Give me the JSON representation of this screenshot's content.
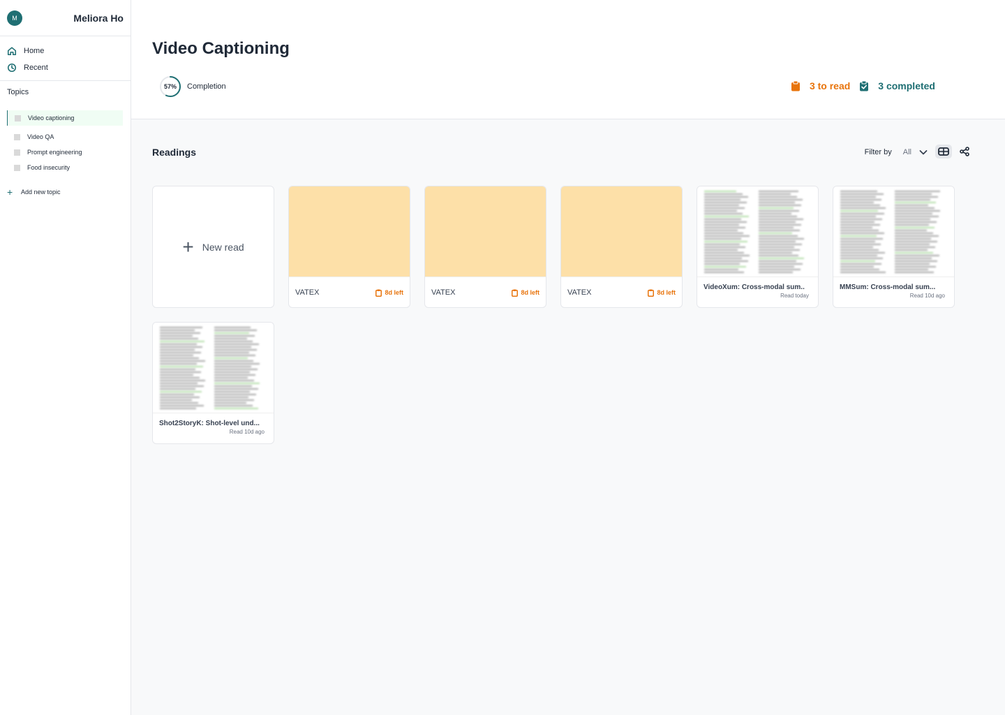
{
  "user": {
    "initial": "M",
    "name": "Meliora Ho"
  },
  "nav": [
    {
      "label": "Home",
      "icon": "home-icon"
    },
    {
      "label": "Recent",
      "icon": "clock-icon"
    }
  ],
  "topics": {
    "title": "Topics",
    "items": [
      {
        "label": "Video captioning",
        "active": true
      },
      {
        "label": "Video QA"
      },
      {
        "label": "Prompt engineering"
      },
      {
        "label": "Food insecurity"
      }
    ],
    "add_label": "Add new topic"
  },
  "header": {
    "title": "Video Captioning",
    "completion_percent": "57%",
    "completion_fraction": 0.57,
    "completion_label": "Completion",
    "to_read": "3 to read",
    "completed": "3 completed"
  },
  "readings": {
    "title": "Readings",
    "filter_label": "Filter by",
    "filter_value": "All",
    "new_read_label": "New read",
    "cards": [
      {
        "type": "todo",
        "name": "VATEX",
        "due": "8d left"
      },
      {
        "type": "todo",
        "name": "VATEX",
        "due": "8d left"
      },
      {
        "type": "todo",
        "name": "VATEX",
        "due": "8d left"
      },
      {
        "type": "paper",
        "name": "VideoXum: Cross-modal sum..",
        "sub": "Read today"
      },
      {
        "type": "paper",
        "name": "MMSum: Cross-modal sum...",
        "sub": "Read 10d ago"
      },
      {
        "type": "paper",
        "name": "Shot2StoryK: Shot-level und...",
        "sub": "Read 10d ago"
      }
    ]
  },
  "colors": {
    "accent": "#1f6f73",
    "orange": "#e8740c",
    "thumb": "#fde0a8"
  }
}
